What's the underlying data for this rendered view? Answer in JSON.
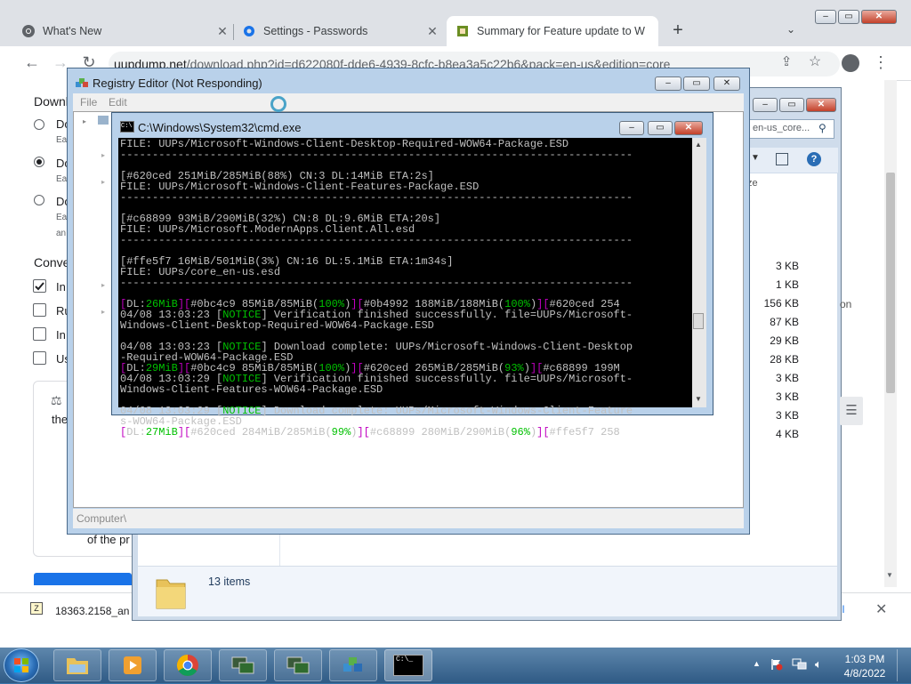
{
  "browser": {
    "tabs": [
      {
        "title": "What's New",
        "icon": "chrome-icon"
      },
      {
        "title": "Settings - Passwords",
        "icon": "gear-icon"
      },
      {
        "title": "Summary for Feature update to W",
        "icon": "uupdump-icon"
      }
    ],
    "url_host": "uupdump.net",
    "url_path": "/download.php?id=d622080f-dde6-4939-8cfc-b8ea3a5c22b6&pack=en-us&edition=core"
  },
  "page": {
    "heading_partial": "Downl",
    "radio_labels": [
      "Do",
      "Do",
      "Do"
    ],
    "radio_sublabels": [
      "Ea",
      "Ea",
      "Ea"
    ],
    "radio_sublabel_extra": "an",
    "section_partial": "Conve",
    "checkbox_labels": [
      "In",
      "Ru",
      "In",
      "Us"
    ],
    "info_text": "the",
    "footer_text": "of the pr",
    "sizes": [
      "3 KB",
      "1 KB",
      "156 KB",
      "87 KB",
      "29 KB",
      "28 KB",
      "3 KB",
      "3 KB",
      "3 KB",
      "4 KB"
    ],
    "side_partial": "ze",
    "side_partial2": "on"
  },
  "download_bar": {
    "file": "18363.2158_an",
    "show_all": "ll"
  },
  "explorer": {
    "search": "en-us_core...",
    "status": "13 items"
  },
  "regedit": {
    "title": "Registry Editor (Not Responding)",
    "menu": [
      "File",
      "Edit"
    ],
    "status": "Computer\\"
  },
  "cmd": {
    "title": "C:\\Windows\\System32\\cmd.exe",
    "lines": [
      "FILE: UUPs/Microsoft-Windows-Client-Desktop-Required-WOW64-Package.ESD",
      "--------------------------------------------------------------------------------",
      "",
      "[#620ced 251MiB/285MiB(88%) CN:3 DL:14MiB ETA:2s]",
      "FILE: UUPs/Microsoft-Windows-Client-Features-Package.ESD",
      "--------------------------------------------------------------------------------",
      "",
      "[#c68899 93MiB/290MiB(32%) CN:8 DL:9.6MiB ETA:20s]",
      "FILE: UUPs/Microsoft.ModernApps.Client.All.esd",
      "--------------------------------------------------------------------------------",
      "",
      "[#ffe5f7 16MiB/501MiB(3%) CN:16 DL:5.1MiB ETA:1m34s]",
      "FILE: UUPs/core_en-us.esd",
      "--------------------------------------------------------------------------------",
      "",
      "DL_LINE_1",
      "04/08 13:03:23 [NOTICE] Verification finished successfully. file=UUPs/Microsoft-",
      "Windows-Client-Desktop-Required-WOW64-Package.ESD",
      "",
      "04/08 13:03:23 [NOTICE] Download complete: UUPs/Microsoft-Windows-Client-Desktop",
      "-Required-WOW64-Package.ESD",
      "DL_LINE_2",
      "04/08 13:03:29 [NOTICE] Verification finished successfully. file=UUPs/Microsoft-",
      "Windows-Client-Features-WOW64-Package.ESD",
      "",
      "04/08 13:03:29 [NOTICE] Download complete: UUPs/Microsoft-Windows-Client-Feature",
      "s-WOW64-Package.ESD",
      "DL_LINE_3"
    ],
    "dl1": {
      "speed": "26MiB",
      "a": "#0bc4c9 85MiB/85MiB",
      "ap": "100%",
      "b": "#0b4992 188MiB/188MiB",
      "bp": "100%",
      "c": "#620ced 254"
    },
    "dl2": {
      "speed": "29MiB",
      "a": "#0bc4c9 85MiB/85MiB",
      "ap": "100%",
      "b": "#620ced 265MiB/285MiB",
      "bp": "93%",
      "c": "#c68899 199M"
    },
    "dl3": {
      "speed": "27MiB",
      "a": "#620ced 284MiB/285MiB",
      "ap": "99%",
      "b": "#c68899 280MiB/290MiB",
      "bp": "96%",
      "c": "#ffe5f7 258"
    }
  },
  "taskbar": {
    "time": "1:03 PM",
    "date": "4/8/2022"
  }
}
